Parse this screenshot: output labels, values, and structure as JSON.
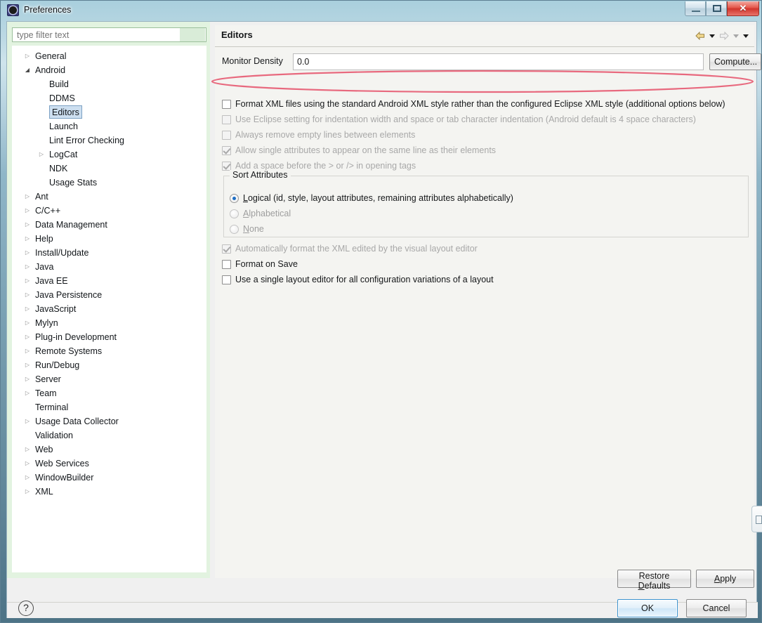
{
  "window": {
    "title": "Preferences",
    "icon": "preferences-gear-icon",
    "buttons": {
      "minimize": "minimize",
      "maximize": "maximize",
      "close": "✕"
    }
  },
  "filter": {
    "placeholder": "type filter text",
    "value": ""
  },
  "tree": {
    "selected": "Editors",
    "items": [
      {
        "label": "General",
        "level": 0,
        "arrow": "collapsed"
      },
      {
        "label": "Android",
        "level": 0,
        "arrow": "expanded"
      },
      {
        "label": "Build",
        "level": 1,
        "arrow": "none"
      },
      {
        "label": "DDMS",
        "level": 1,
        "arrow": "none"
      },
      {
        "label": "Editors",
        "level": 1,
        "arrow": "none",
        "selected": true
      },
      {
        "label": "Launch",
        "level": 1,
        "arrow": "none"
      },
      {
        "label": "Lint Error Checking",
        "level": 1,
        "arrow": "none"
      },
      {
        "label": "LogCat",
        "level": 1,
        "arrow": "collapsed"
      },
      {
        "label": "NDK",
        "level": 1,
        "arrow": "none"
      },
      {
        "label": "Usage Stats",
        "level": 1,
        "arrow": "none"
      },
      {
        "label": "Ant",
        "level": 0,
        "arrow": "collapsed"
      },
      {
        "label": "C/C++",
        "level": 0,
        "arrow": "collapsed"
      },
      {
        "label": "Data Management",
        "level": 0,
        "arrow": "collapsed"
      },
      {
        "label": "Help",
        "level": 0,
        "arrow": "collapsed"
      },
      {
        "label": "Install/Update",
        "level": 0,
        "arrow": "collapsed"
      },
      {
        "label": "Java",
        "level": 0,
        "arrow": "collapsed"
      },
      {
        "label": "Java EE",
        "level": 0,
        "arrow": "collapsed"
      },
      {
        "label": "Java Persistence",
        "level": 0,
        "arrow": "collapsed"
      },
      {
        "label": "JavaScript",
        "level": 0,
        "arrow": "collapsed"
      },
      {
        "label": "Mylyn",
        "level": 0,
        "arrow": "collapsed"
      },
      {
        "label": "Plug-in Development",
        "level": 0,
        "arrow": "collapsed"
      },
      {
        "label": "Remote Systems",
        "level": 0,
        "arrow": "collapsed"
      },
      {
        "label": "Run/Debug",
        "level": 0,
        "arrow": "collapsed"
      },
      {
        "label": "Server",
        "level": 0,
        "arrow": "collapsed"
      },
      {
        "label": "Team",
        "level": 0,
        "arrow": "collapsed"
      },
      {
        "label": "Terminal",
        "level": 0,
        "arrow": "none"
      },
      {
        "label": "Usage Data Collector",
        "level": 0,
        "arrow": "collapsed"
      },
      {
        "label": "Validation",
        "level": 0,
        "arrow": "none"
      },
      {
        "label": "Web",
        "level": 0,
        "arrow": "collapsed"
      },
      {
        "label": "Web Services",
        "level": 0,
        "arrow": "collapsed"
      },
      {
        "label": "WindowBuilder",
        "level": 0,
        "arrow": "collapsed"
      },
      {
        "label": "XML",
        "level": 0,
        "arrow": "collapsed"
      }
    ]
  },
  "page": {
    "title": "Editors",
    "nav": {
      "back": "back-arrow-icon",
      "back_menu": "back-history-dropdown-icon",
      "forward": "forward-arrow-icon",
      "forward_menu": "forward-history-dropdown-icon",
      "view_menu": "view-menu-dropdown-icon"
    },
    "density": {
      "label": "Monitor Density",
      "value": "0.0",
      "placeholder": "",
      "compute_label": "Compute..."
    },
    "checkboxes": [
      {
        "label": "Format XML files using the standard Android XML style rather than the configured Eclipse XML style (additional options below)",
        "checked": false,
        "enabled": true,
        "annotated": true
      },
      {
        "label": "Use Eclipse setting for indentation width and space or tab character indentation (Android default is 4 space characters)",
        "checked": false,
        "enabled": false
      },
      {
        "label": "Always remove empty lines between elements",
        "checked": false,
        "enabled": false
      },
      {
        "label": "Allow single attributes to appear on the same line as their elements",
        "checked": true,
        "enabled": false
      },
      {
        "label": "Add a space before the > or /> in opening tags",
        "checked": true,
        "enabled": false
      }
    ],
    "sort_attributes": {
      "legend": "Sort Attributes",
      "options": [
        {
          "label": "Logical (id, style, layout attributes, remaining attributes alphabetically)",
          "mnemonic": "L",
          "selected": true,
          "enabled": true
        },
        {
          "label": "Alphabetical",
          "mnemonic": "A",
          "selected": false,
          "enabled": false
        },
        {
          "label": "None",
          "mnemonic": "N",
          "selected": false,
          "enabled": false
        }
      ]
    },
    "checkboxes_bottom": [
      {
        "label": "Automatically format the XML edited by the visual layout editor",
        "checked": true,
        "enabled": false
      },
      {
        "label": "Format on Save",
        "checked": false,
        "enabled": true
      },
      {
        "label": "Use a single layout editor for all configuration variations of a layout",
        "checked": false,
        "enabled": true
      }
    ],
    "buttons": {
      "restore_defaults": "Restore Defaults",
      "restore_mnemonic": "D",
      "apply": "Apply",
      "apply_mnemonic": "A"
    }
  },
  "footer": {
    "help": "?",
    "ok": "OK",
    "cancel": "Cancel"
  },
  "annotation": {
    "shape": "red-ellipse-highlight",
    "color": "#e8697e",
    "targets": "format-xml-checkbox-row"
  }
}
